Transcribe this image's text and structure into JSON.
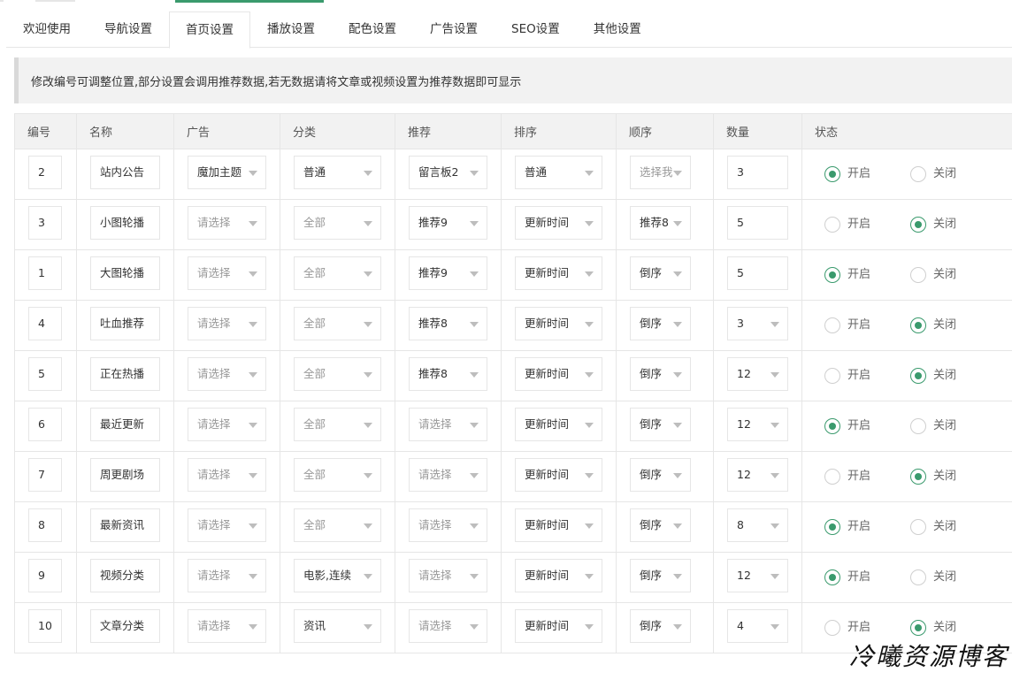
{
  "tabs": [
    {
      "label": "欢迎使用",
      "active": false
    },
    {
      "label": "导航设置",
      "active": false
    },
    {
      "label": "首页设置",
      "active": true
    },
    {
      "label": "播放设置",
      "active": false
    },
    {
      "label": "配色设置",
      "active": false
    },
    {
      "label": "广告设置",
      "active": false
    },
    {
      "label": "SEO设置",
      "active": false
    },
    {
      "label": "其他设置",
      "active": false
    }
  ],
  "notice": "修改编号可调整位置,部分设置会调用推荐数据,若无数据请将文章或视频设置为推荐数据即可显示",
  "columns": [
    "编号",
    "名称",
    "广告",
    "分类",
    "推荐",
    "排序",
    "顺序",
    "数量",
    "状态"
  ],
  "radio_labels": {
    "on": "开启",
    "off": "关闭"
  },
  "rows": [
    {
      "id": "2",
      "name": "站内公告",
      "ad": "魔加主题",
      "ad_ph": false,
      "category": "普通",
      "category_ph": false,
      "recommend": "留言板2",
      "recommend_ph": false,
      "sort": "普通",
      "order": "选择我",
      "order_ph": true,
      "count": "3",
      "count_select": false,
      "enabled": true
    },
    {
      "id": "3",
      "name": "小图轮播",
      "ad": "请选择",
      "ad_ph": true,
      "category": "全部",
      "category_ph": true,
      "recommend": "推荐9",
      "recommend_ph": false,
      "sort": "更新时间",
      "order": "推荐8",
      "order_ph": false,
      "count": "5",
      "count_select": false,
      "enabled": false
    },
    {
      "id": "1",
      "name": "大图轮播",
      "ad": "请选择",
      "ad_ph": true,
      "category": "全部",
      "category_ph": true,
      "recommend": "推荐9",
      "recommend_ph": false,
      "sort": "更新时间",
      "order": "倒序",
      "order_ph": false,
      "count": "5",
      "count_select": false,
      "enabled": true
    },
    {
      "id": "4",
      "name": "吐血推荐",
      "ad": "请选择",
      "ad_ph": true,
      "category": "全部",
      "category_ph": true,
      "recommend": "推荐8",
      "recommend_ph": false,
      "sort": "更新时间",
      "order": "倒序",
      "order_ph": false,
      "count": "3",
      "count_select": true,
      "enabled": false
    },
    {
      "id": "5",
      "name": "正在热播",
      "ad": "请选择",
      "ad_ph": true,
      "category": "全部",
      "category_ph": true,
      "recommend": "推荐8",
      "recommend_ph": false,
      "sort": "更新时间",
      "order": "倒序",
      "order_ph": false,
      "count": "12",
      "count_select": true,
      "enabled": false
    },
    {
      "id": "6",
      "name": "最近更新",
      "ad": "请选择",
      "ad_ph": true,
      "category": "全部",
      "category_ph": true,
      "recommend": "请选择",
      "recommend_ph": true,
      "sort": "更新时间",
      "order": "倒序",
      "order_ph": false,
      "count": "12",
      "count_select": true,
      "enabled": true
    },
    {
      "id": "7",
      "name": "周更剧场",
      "ad": "请选择",
      "ad_ph": true,
      "category": "全部",
      "category_ph": true,
      "recommend": "请选择",
      "recommend_ph": true,
      "sort": "更新时间",
      "order": "倒序",
      "order_ph": false,
      "count": "12",
      "count_select": true,
      "enabled": false
    },
    {
      "id": "8",
      "name": "最新资讯",
      "ad": "请选择",
      "ad_ph": true,
      "category": "全部",
      "category_ph": true,
      "recommend": "请选择",
      "recommend_ph": true,
      "sort": "更新时间",
      "order": "倒序",
      "order_ph": false,
      "count": "8",
      "count_select": true,
      "enabled": true
    },
    {
      "id": "9",
      "name": "视频分类",
      "ad": "请选择",
      "ad_ph": true,
      "category": "电影,连续",
      "category_ph": false,
      "recommend": "请选择",
      "recommend_ph": true,
      "sort": "更新时间",
      "order": "倒序",
      "order_ph": false,
      "count": "12",
      "count_select": true,
      "enabled": true
    },
    {
      "id": "10",
      "name": "文章分类",
      "ad": "请选择",
      "ad_ph": true,
      "category": "资讯",
      "category_ph": false,
      "recommend": "请选择",
      "recommend_ph": true,
      "sort": "更新时间",
      "order": "倒序",
      "order_ph": false,
      "count": "4",
      "count_select": true,
      "enabled": false
    }
  ],
  "watermark": "冷曦资源博客",
  "colors": {
    "accent": "#3a9a6d",
    "border": "#e6e6e6",
    "header_bg": "#f2f2f2",
    "placeholder": "#999999"
  }
}
